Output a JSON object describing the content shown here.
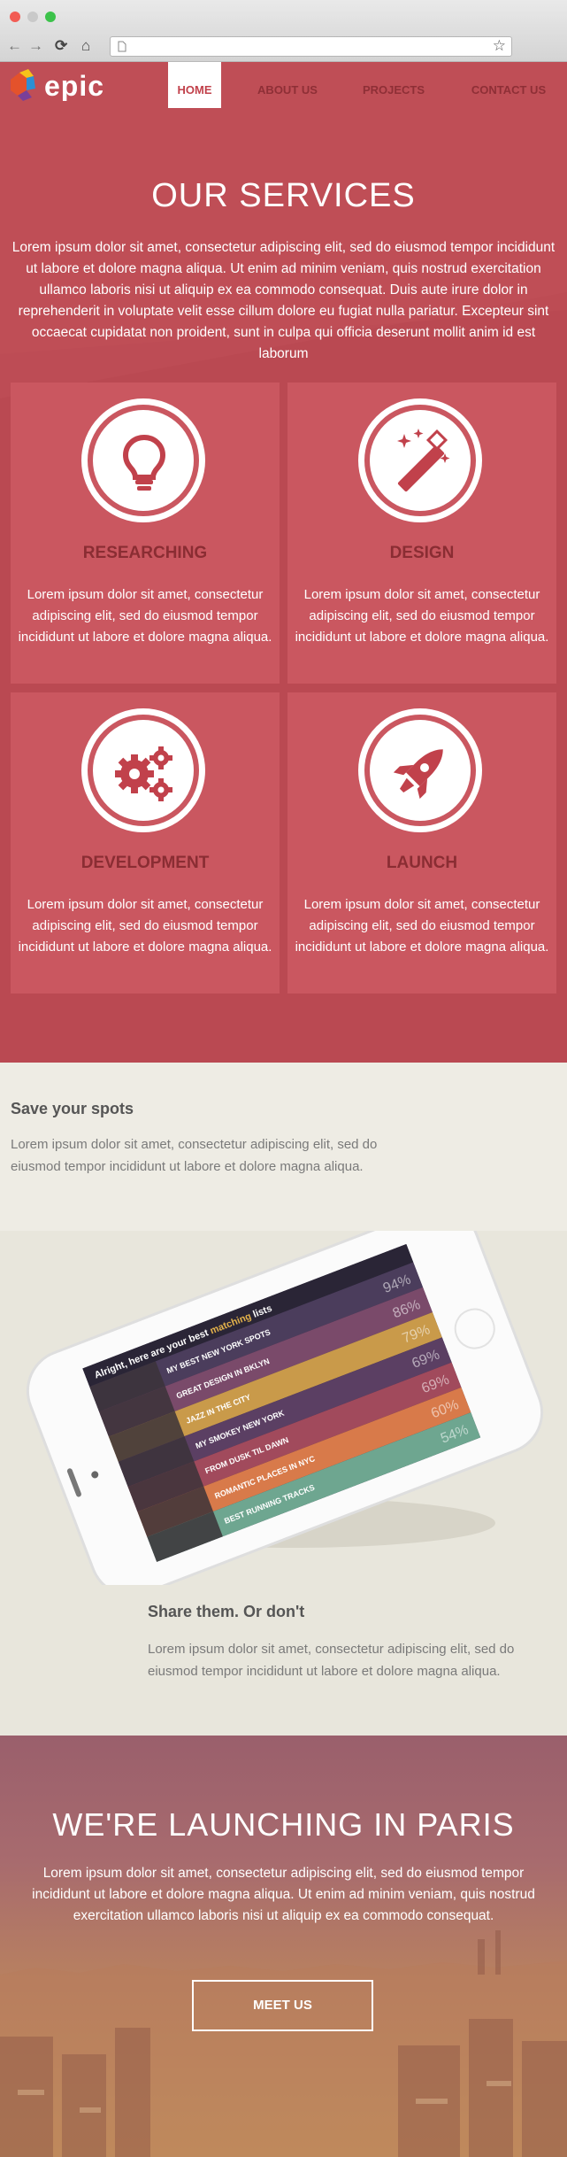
{
  "browser": {
    "url": "",
    "back_glyph": "←",
    "forward_glyph": "→",
    "reload_glyph": "⟳",
    "home_glyph": "⌂",
    "star_glyph": "☆"
  },
  "logo": {
    "text": "epic"
  },
  "nav": {
    "items": [
      "HOME",
      "ABOUT US",
      "PROJECTS",
      "CONTACT US"
    ],
    "active": 0
  },
  "services": {
    "title": "OUR SERVICES",
    "text": "Lorem ipsum dolor sit amet, consectetur adipiscing elit, sed do eiusmod tempor incididunt ut labore et dolore magna aliqua. Ut enim ad minim veniam, quis nostrud exercitation ullamco laboris nisi ut aliquip ex ea commodo consequat. Duis aute irure dolor in reprehenderit in voluptate velit esse cillum dolore eu fugiat nulla pariatur. Excepteur sint occaecat cupidatat non proident, sunt in culpa qui officia deserunt mollit anim id est laborum",
    "cards": [
      {
        "title": "RESEARCHING",
        "icon": "lightbulb-icon",
        "text": "Lorem ipsum dolor sit amet, consectetur adipiscing elit, sed do eiusmod tempor incididunt ut labore et dolore magna aliqua."
      },
      {
        "title": "DESIGN",
        "icon": "magic-wand-icon",
        "text": "Lorem ipsum dolor sit amet, consectetur adipiscing elit, sed do eiusmod tempor incididunt ut labore et dolore magna aliqua."
      },
      {
        "title": "DEVELOPMENT",
        "icon": "gears-icon",
        "text": "Lorem ipsum dolor sit amet, consectetur adipiscing elit, sed do eiusmod tempor incididunt ut labore et dolore magna aliqua."
      },
      {
        "title": "LAUNCH",
        "icon": "rocket-icon",
        "text": "Lorem ipsum dolor sit amet, consectetur adipiscing elit, sed do eiusmod tempor incididunt ut labore et dolore magna aliqua."
      }
    ]
  },
  "save": {
    "title": "Save your spots",
    "text": "Lorem ipsum dolor sit amet, consectetur adipiscing elit, sed do eiusmod tempor incididunt ut labore et dolore magna aliqua."
  },
  "share": {
    "title": "Share them. Or don't",
    "text": "Lorem ipsum dolor sit amet, consectetur adipiscing elit, sed do eiusmod tempor incididunt ut labore et dolore magna aliqua."
  },
  "phone": {
    "header_prefix": "Alright, here are your best",
    "header_highlight": "matching",
    "header_suffix": "lists",
    "items": [
      {
        "title": "MY BEST NEW YORK SPOTS",
        "score": "94%",
        "color": "#4b3d5c"
      },
      {
        "title": "GREAT DESIGN IN BKLYN",
        "score": "86%",
        "color": "#7a4a6a"
      },
      {
        "title": "JAZZ IN THE CITY",
        "score": "79%",
        "color": "#c99a4a"
      },
      {
        "title": "MY SMOKEY NEW YORK",
        "score": "69%",
        "color": "#5b3f63"
      },
      {
        "title": "FROM DUSK TIL DAWN",
        "score": "69%",
        "color": "#a14a5c"
      },
      {
        "title": "ROMANTIC PLACES IN NYC",
        "score": "60%",
        "color": "#d87a4a"
      },
      {
        "title": "BEST RUNNING TRACKS",
        "score": "54%",
        "color": "#6ea690"
      }
    ]
  },
  "launch": {
    "title": "WE'RE LAUNCHING IN PARIS",
    "text": "Lorem ipsum dolor sit amet, consectetur adipiscing elit, sed do eiusmod tempor incididunt ut labore et dolore magna aliqua. Ut enim ad minim veniam, quis nostrud exercitation ullamco laboris nisi ut aliquip ex ea commodo consequat.",
    "button": "MEET US"
  },
  "colors": {
    "hero": "#bd4c54",
    "card": "#ca5760",
    "accent": "#c1414b",
    "dark_title": "#8a2d33"
  }
}
